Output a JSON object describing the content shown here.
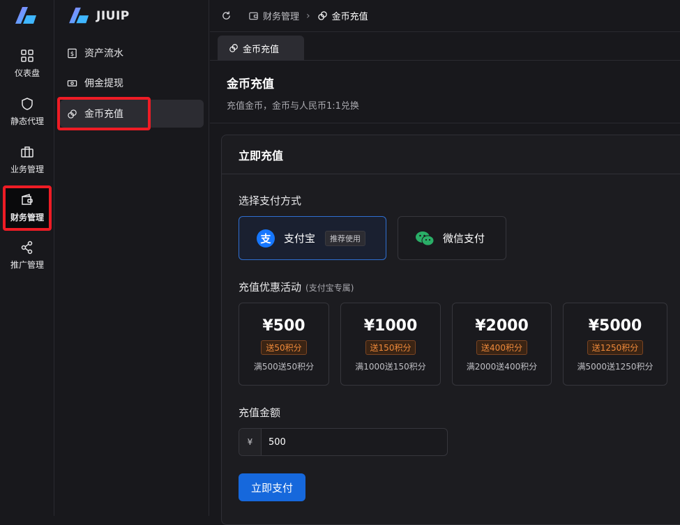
{
  "brand": {
    "name": "JIUIP"
  },
  "rail": {
    "items": [
      {
        "label": "仪表盘",
        "icon": "dashboard-icon"
      },
      {
        "label": "静态代理",
        "icon": "shield-icon"
      },
      {
        "label": "业务管理",
        "icon": "briefcase-icon"
      },
      {
        "label": "财务管理",
        "icon": "wallet-icon",
        "active": true
      },
      {
        "label": "推广管理",
        "icon": "share-icon"
      }
    ]
  },
  "sidebar": {
    "items": [
      {
        "label": "资产流水",
        "icon": "dollar-doc-icon"
      },
      {
        "label": "佣金提现",
        "icon": "cash-icon"
      },
      {
        "label": "金币充值",
        "icon": "coins-icon",
        "active": true
      }
    ]
  },
  "breadcrumb": {
    "parent": "财务管理",
    "current": "金币充值"
  },
  "tabs": [
    {
      "label": "金币充值"
    }
  ],
  "page": {
    "title": "金币充值",
    "description": "充值金币，金币与人民币1:1兑换"
  },
  "card": {
    "title": "立即充值",
    "payment_label": "选择支付方式",
    "payment_methods": [
      {
        "name": "支付宝",
        "tag": "推荐使用",
        "icon": "alipay-icon",
        "selected": true
      },
      {
        "name": "微信支付",
        "icon": "wechat-icon"
      }
    ],
    "promo_label": "充值优惠活动",
    "promo_sub": "(支付宝专属)",
    "promos": [
      {
        "amount": "¥500",
        "bonus": "送50积分",
        "desc": "满500送50积分"
      },
      {
        "amount": "¥1000",
        "bonus": "送150积分",
        "desc": "满1000送150积分"
      },
      {
        "amount": "¥2000",
        "bonus": "送400积分",
        "desc": "满2000送400积分"
      },
      {
        "amount": "¥5000",
        "bonus": "送1250积分",
        "desc": "满5000送1250积分"
      }
    ],
    "amount_label": "充值金额",
    "currency_prefix": "¥",
    "amount_value": "500",
    "submit_label": "立即支付"
  },
  "colors": {
    "accent": "#1668dc",
    "highlight": "#ee1c25",
    "bonus": "#f08a3a",
    "alipay": "#1677ff",
    "wechat": "#2aae67"
  }
}
